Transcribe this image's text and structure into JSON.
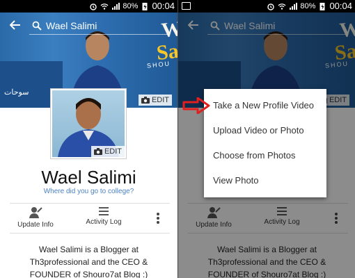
{
  "status_bar": {
    "battery_pct": "80%",
    "time": "00:04"
  },
  "search": {
    "query": "Wael Salimi"
  },
  "cover": {
    "line1": "W",
    "line2": "Sal",
    "line3": "SHOU",
    "arabic": "سوحات"
  },
  "edit_label": "EDIT",
  "profile": {
    "name": "Wael Salimi",
    "prompt": "Where did you go to college?",
    "bio": "Wael Salimi is a Blogger at Th3professional and the CEO & FOUNDER of Shouro7at Blog :)"
  },
  "actions": {
    "update_info": "Update Info",
    "activity_log": "Activity Log"
  },
  "menu": {
    "items": [
      "Take a New Profile Video",
      "Upload Video or Photo",
      "Choose from Photos",
      "View Photo"
    ]
  },
  "colors": {
    "link": "#4b82c4",
    "arrow": "#e0201e",
    "cover": "#2d6cae"
  }
}
